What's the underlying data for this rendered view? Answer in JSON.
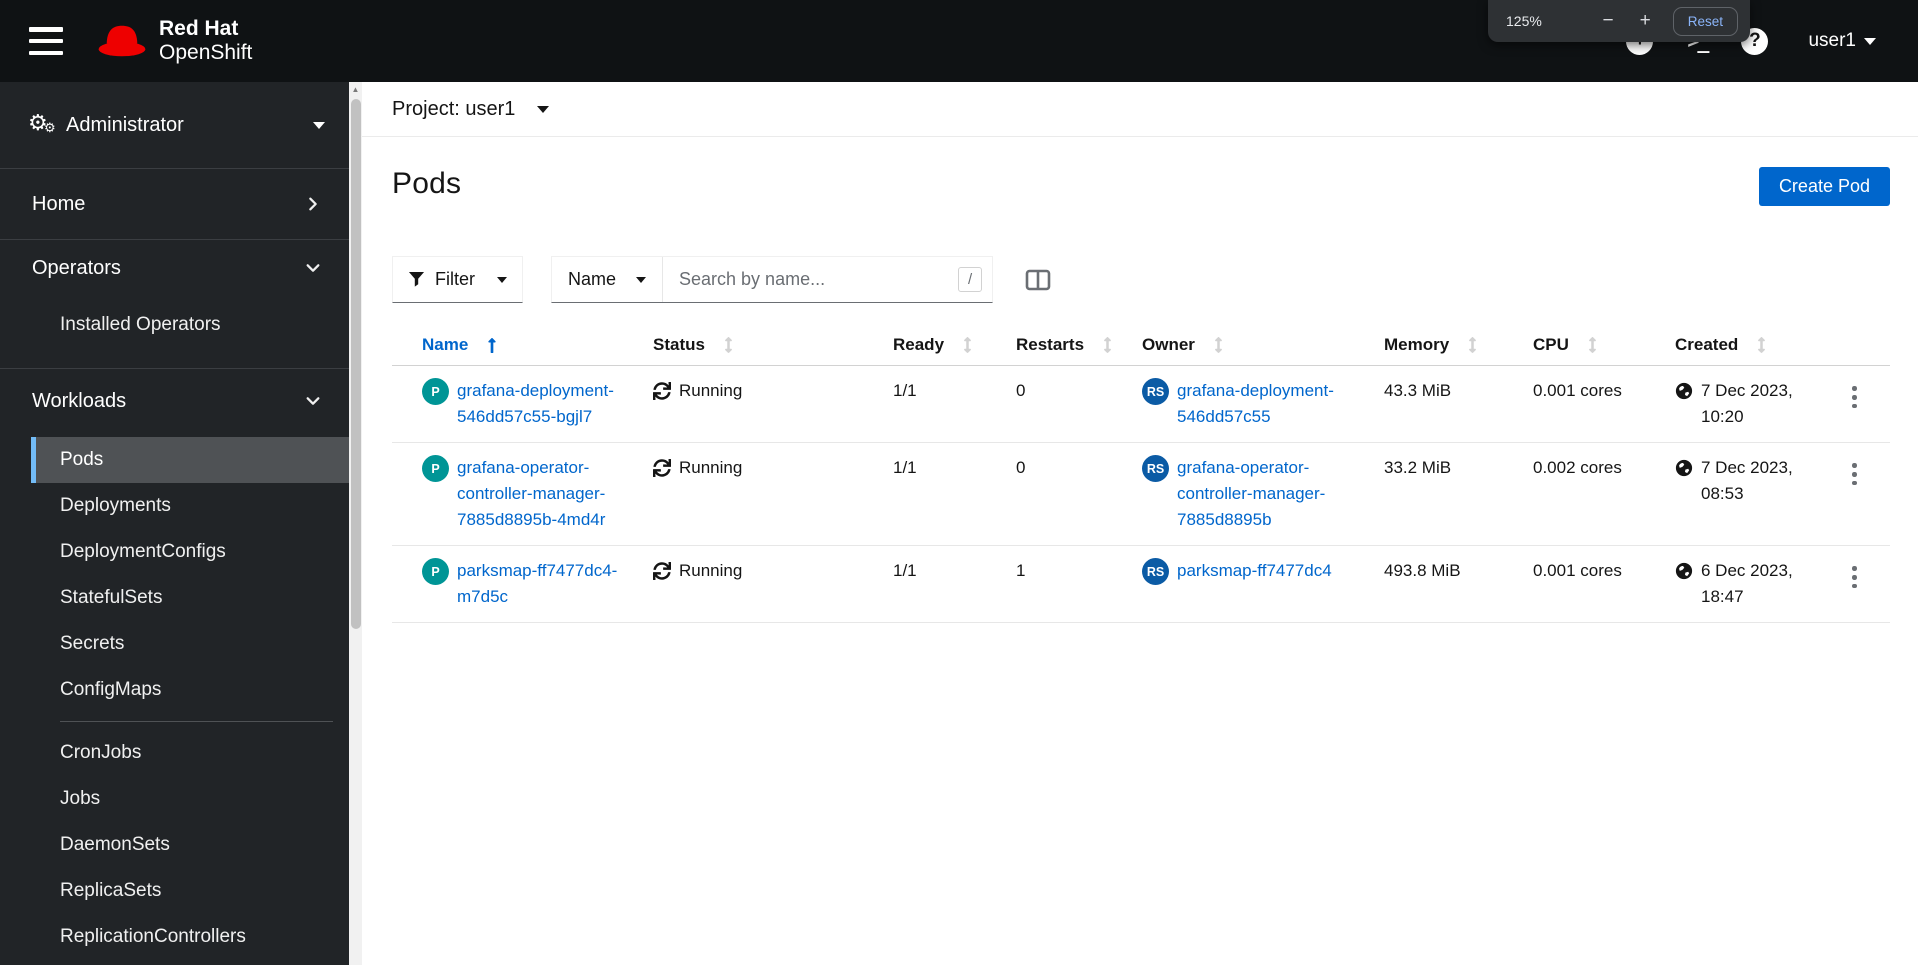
{
  "masthead": {
    "brand_line1": "Red Hat",
    "brand_line2": "OpenShift",
    "username": "user1"
  },
  "zoom_popup": {
    "level": "125%",
    "minus": "−",
    "plus": "+",
    "reset_label": "Reset"
  },
  "icons": {
    "terminal": ">_",
    "plus_circle": "+",
    "help": "?",
    "gear_big": "⚙",
    "gear_small": "⚙",
    "scrollbar_up": "▲",
    "slash_shortcut": "/"
  },
  "sidebar": {
    "perspective": "Administrator",
    "home": "Home",
    "operators": "Operators",
    "operators_items": [
      "Installed Operators"
    ],
    "workloads": "Workloads",
    "workloads_items": [
      "Pods",
      "Deployments",
      "DeploymentConfigs",
      "StatefulSets",
      "Secrets",
      "ConfigMaps",
      "CronJobs",
      "Jobs",
      "DaemonSets",
      "ReplicaSets",
      "ReplicationControllers"
    ],
    "active_item": "Pods"
  },
  "project_bar": {
    "label": "Project: user1"
  },
  "page": {
    "title": "Pods",
    "create_button": "Create Pod"
  },
  "toolbar": {
    "filter_label": "Filter",
    "name_label": "Name",
    "search_placeholder": "Search by name...",
    "shortcut": "/"
  },
  "table": {
    "columns": [
      "Name",
      "Status",
      "Ready",
      "Restarts",
      "Owner",
      "Memory",
      "CPU",
      "Created"
    ],
    "sorted_column": "Name",
    "sort_direction": "ascending",
    "rows": [
      {
        "badge": "P",
        "name_lines": [
          "grafana-deployment-",
          "546dd57c55-bgjl7"
        ],
        "status": "Running",
        "ready": "1/1",
        "restarts": "0",
        "owner_badge": "RS",
        "owner_lines": [
          "grafana-deployment-",
          "546dd57c55"
        ],
        "memory": "43.3 MiB",
        "cpu": "0.001 cores",
        "created_date": "7 Dec 2023,",
        "created_time": "10:20"
      },
      {
        "badge": "P",
        "name_lines": [
          "grafana-operator-",
          "controller-manager-",
          "7885d8895b-4md4r"
        ],
        "status": "Running",
        "ready": "1/1",
        "restarts": "0",
        "owner_badge": "RS",
        "owner_lines": [
          "grafana-operator-",
          "controller-manager-",
          "7885d8895b"
        ],
        "memory": "33.2 MiB",
        "cpu": "0.002 cores",
        "created_date": "7 Dec 2023,",
        "created_time": "08:53"
      },
      {
        "badge": "P",
        "name_lines": [
          "parksmap-ff7477dc4-",
          "m7d5c"
        ],
        "status": "Running",
        "ready": "1/1",
        "restarts": "1",
        "owner_badge": "RS",
        "owner_lines": [
          "parksmap-ff7477dc4"
        ],
        "memory": "493.8 MiB",
        "cpu": "0.001 cores",
        "created_date": "6 Dec 2023,",
        "created_time": "18:47"
      }
    ]
  },
  "colors": {
    "brand_red": "#ee0000",
    "masthead_bg": "#0f1214",
    "sidebar_bg": "#212427",
    "nav_active_bg": "#4f5255",
    "nav_active_border": "#73bcf7",
    "link_blue": "#0066cc",
    "button_blue": "#0066cc",
    "pod_badge_teal": "#009596",
    "rs_badge_blue": "#0b5ba5"
  }
}
